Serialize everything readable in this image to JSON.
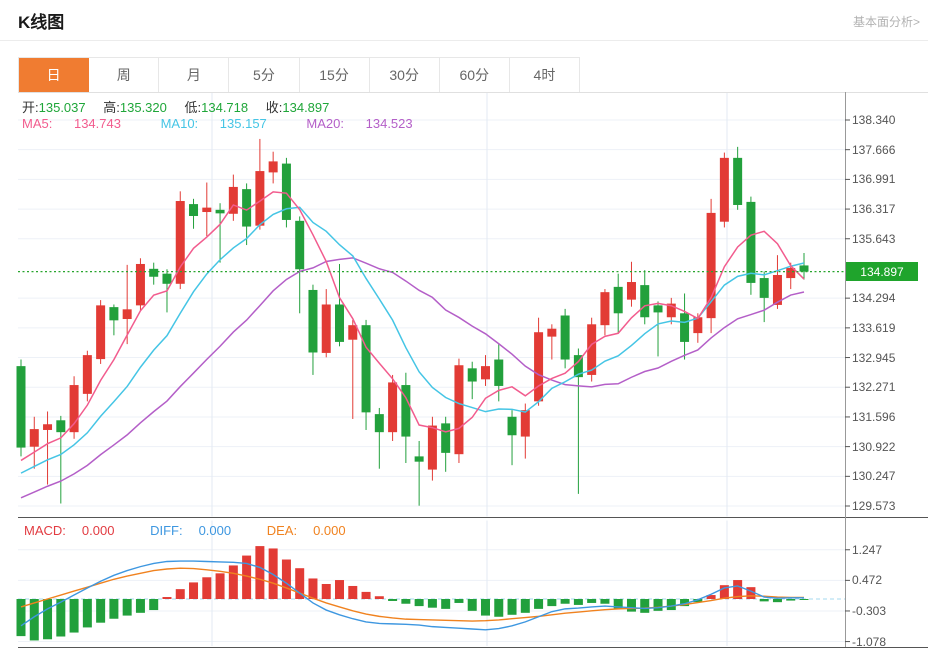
{
  "header": {
    "title": "K线图",
    "link_label": "基本面分析>"
  },
  "tabs": {
    "items": [
      "日",
      "周",
      "月",
      "5分",
      "15分",
      "30分",
      "60分",
      "4时"
    ],
    "selected_index": 0
  },
  "info": {
    "open_label": "开:",
    "open": "135.037",
    "high_label": "高:",
    "high": "135.320",
    "low_label": "低:",
    "low": "134.718",
    "close_label": "收:",
    "close": "134.897",
    "ma5_label": "MA5:",
    "ma5": "134.743",
    "ma10_label": "MA10:",
    "ma10": "135.157",
    "ma20_label": "MA20:",
    "ma20": "134.523"
  },
  "macd_info": {
    "macd_label": "MACD:",
    "macd": "0.000",
    "diff_label": "DIFF:",
    "diff": "0.000",
    "dea_label": "DEA:",
    "dea": "0.000"
  },
  "axis": {
    "price_badge": "134.897"
  },
  "colors": {
    "up": "#e23b35",
    "down": "#22a03c",
    "ma5": "#f25c8e",
    "ma10": "#45c5e5",
    "ma20": "#b45fc8",
    "diff": "#3e97e0",
    "dea": "#f0821f",
    "tab_accent": "#f07c31",
    "badge_bg": "#1fa42c",
    "grid": "#edf1f7",
    "vgrid": "#e3eaf3",
    "dotted_price": "#28a52e",
    "macd_zero": "#a6d9ef",
    "axis_line": "#999",
    "pane_line": "#555",
    "axis_text": "#555",
    "value_green": "#1fa639"
  },
  "chart_data": {
    "type": "candlestick+macd",
    "main": {
      "title": "K线图 daily candlesticks",
      "y_ticks": [
        138.34,
        137.666,
        136.991,
        136.317,
        135.643,
        134.294,
        133.619,
        132.945,
        132.271,
        131.596,
        130.922,
        130.247,
        129.573
      ],
      "current_price": 134.897,
      "last_ohlc": {
        "open": 135.037,
        "high": 135.32,
        "low": 134.718,
        "close": 134.897
      },
      "ma_labels": {
        "ma5": 134.743,
        "ma10": 135.157,
        "ma20": 134.523
      },
      "ma_periods": [
        5,
        10,
        20
      ],
      "ma_seed_closes": [
        128.7,
        128.81,
        128.92,
        129.03,
        129.14,
        129.26,
        129.37,
        129.48,
        129.59,
        129.7,
        129.81,
        129.92,
        130.03,
        130.14,
        130.26,
        130.37,
        130.48,
        130.59,
        130.7
      ],
      "vertical_gridlines_x": [
        212,
        487,
        727
      ],
      "candles": [
        [
          132.75,
          132.9,
          130.7,
          130.9
        ],
        [
          130.92,
          131.6,
          130.42,
          131.32
        ],
        [
          131.3,
          131.72,
          130.06,
          131.43
        ],
        [
          131.52,
          131.62,
          129.63,
          131.25
        ],
        [
          131.25,
          132.52,
          131.1,
          132.32
        ],
        [
          132.12,
          133.1,
          131.95,
          133.0
        ],
        [
          132.91,
          134.25,
          132.8,
          134.13
        ],
        [
          134.09,
          134.15,
          133.45,
          133.79
        ],
        [
          133.82,
          135.05,
          133.25,
          134.04
        ],
        [
          134.13,
          135.2,
          134.0,
          135.07
        ],
        [
          134.96,
          135.1,
          134.6,
          134.78
        ],
        [
          134.85,
          134.95,
          133.97,
          134.62
        ],
        [
          134.62,
          136.72,
          134.5,
          136.5
        ],
        [
          136.43,
          136.55,
          135.87,
          136.16
        ],
        [
          136.25,
          136.92,
          135.7,
          136.35
        ],
        [
          136.3,
          136.45,
          135.1,
          136.22
        ],
        [
          136.21,
          137.1,
          136.05,
          136.82
        ],
        [
          136.77,
          136.9,
          135.5,
          135.92
        ],
        [
          135.94,
          137.91,
          135.85,
          137.18
        ],
        [
          137.15,
          137.62,
          136.9,
          137.4
        ],
        [
          137.35,
          137.48,
          135.9,
          136.07
        ],
        [
          136.05,
          136.15,
          133.95,
          134.95
        ],
        [
          134.48,
          134.6,
          132.55,
          133.06
        ],
        [
          133.05,
          134.5,
          132.95,
          134.15
        ],
        [
          134.15,
          135.07,
          133.2,
          133.3
        ],
        [
          133.35,
          133.8,
          131.55,
          133.68
        ],
        [
          133.68,
          133.8,
          131.3,
          131.7
        ],
        [
          131.66,
          131.8,
          130.42,
          131.25
        ],
        [
          131.25,
          132.55,
          131.05,
          132.38
        ],
        [
          132.32,
          132.6,
          130.55,
          131.15
        ],
        [
          130.7,
          131.05,
          129.58,
          130.58
        ],
        [
          130.4,
          131.6,
          130.15,
          131.4
        ],
        [
          131.45,
          131.6,
          130.35,
          130.78
        ],
        [
          130.75,
          132.92,
          130.55,
          132.77
        ],
        [
          132.7,
          132.85,
          132.0,
          132.4
        ],
        [
          132.45,
          133.0,
          132.3,
          132.75
        ],
        [
          132.9,
          133.25,
          131.95,
          132.3
        ],
        [
          131.6,
          131.75,
          130.5,
          131.18
        ],
        [
          131.15,
          131.9,
          130.65,
          131.75
        ],
        [
          131.95,
          133.85,
          131.85,
          133.52
        ],
        [
          133.42,
          133.7,
          132.9,
          133.6
        ],
        [
          133.9,
          134.05,
          132.7,
          132.9
        ],
        [
          133.0,
          133.15,
          129.85,
          132.5
        ],
        [
          132.55,
          133.85,
          132.4,
          133.7
        ],
        [
          133.68,
          134.5,
          133.45,
          134.43
        ],
        [
          134.55,
          134.85,
          133.5,
          133.95
        ],
        [
          134.26,
          135.12,
          134.1,
          134.66
        ],
        [
          134.59,
          134.93,
          133.7,
          133.86
        ],
        [
          134.13,
          134.22,
          132.97,
          133.97
        ],
        [
          133.86,
          134.3,
          133.7,
          134.17
        ],
        [
          133.95,
          134.4,
          132.9,
          133.3
        ],
        [
          133.5,
          133.95,
          133.28,
          133.86
        ],
        [
          133.84,
          136.55,
          133.5,
          136.23
        ],
        [
          136.03,
          137.6,
          135.9,
          137.48
        ],
        [
          137.48,
          137.73,
          136.3,
          136.41
        ],
        [
          136.48,
          136.6,
          134.37,
          134.64
        ],
        [
          134.75,
          134.9,
          133.75,
          134.3
        ],
        [
          134.14,
          135.27,
          134.05,
          134.82
        ],
        [
          134.75,
          135.1,
          134.5,
          134.98
        ],
        [
          135.037,
          135.32,
          134.718,
          134.897
        ]
      ]
    },
    "macd": {
      "y_ticks": [
        1.247,
        0.472,
        -0.303,
        -1.078
      ],
      "hist": [
        -0.94,
        -1.05,
        -1.02,
        -0.95,
        -0.85,
        -0.72,
        -0.6,
        -0.5,
        -0.42,
        -0.35,
        -0.28,
        0.05,
        0.25,
        0.42,
        0.55,
        0.65,
        0.85,
        1.1,
        1.34,
        1.28,
        1.0,
        0.78,
        0.52,
        0.38,
        0.48,
        0.33,
        0.18,
        0.07,
        -0.05,
        -0.12,
        -0.18,
        -0.22,
        -0.25,
        -0.1,
        -0.3,
        -0.42,
        -0.45,
        -0.4,
        -0.35,
        -0.25,
        -0.18,
        -0.12,
        -0.15,
        -0.1,
        -0.12,
        -0.25,
        -0.32,
        -0.35,
        -0.3,
        -0.28,
        -0.18,
        -0.08,
        0.1,
        0.35,
        0.48,
        0.3,
        -0.06,
        -0.08,
        -0.04,
        -0.02
      ],
      "diff": [
        -0.68,
        -0.45,
        -0.25,
        -0.08,
        0.1,
        0.28,
        0.45,
        0.6,
        0.72,
        0.82,
        0.9,
        0.95,
        0.96,
        0.96,
        0.95,
        0.94,
        0.93,
        0.9,
        0.8,
        0.62,
        0.4,
        0.15,
        -0.1,
        -0.28,
        -0.4,
        -0.5,
        -0.58,
        -0.62,
        -0.63,
        -0.64,
        -0.66,
        -0.7,
        -0.72,
        -0.74,
        -0.76,
        -0.78,
        -0.75,
        -0.68,
        -0.58,
        -0.45,
        -0.32,
        -0.25,
        -0.23,
        -0.2,
        -0.18,
        -0.2,
        -0.22,
        -0.24,
        -0.22,
        -0.18,
        -0.12,
        -0.02,
        0.12,
        0.28,
        0.33,
        0.2,
        0.05,
        0.02,
        0.03,
        0.03
      ],
      "dea": [
        -0.2,
        -0.1,
        0.0,
        0.1,
        0.2,
        0.3,
        0.4,
        0.5,
        0.58,
        0.65,
        0.72,
        0.76,
        0.78,
        0.77,
        0.74,
        0.7,
        0.65,
        0.58,
        0.5,
        0.4,
        0.28,
        0.15,
        0.02,
        -0.1,
        -0.2,
        -0.3,
        -0.38,
        -0.44,
        -0.48,
        -0.51,
        -0.52,
        -0.53,
        -0.54,
        -0.55,
        -0.56,
        -0.55,
        -0.53,
        -0.5,
        -0.47,
        -0.44,
        -0.4,
        -0.36,
        -0.33,
        -0.3,
        -0.27,
        -0.25,
        -0.24,
        -0.23,
        -0.21,
        -0.18,
        -0.14,
        -0.09,
        -0.04,
        0.02,
        0.06,
        0.08,
        0.07,
        0.05,
        0.04,
        0.04
      ]
    }
  }
}
